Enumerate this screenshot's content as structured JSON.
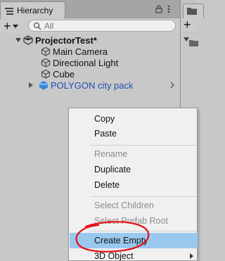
{
  "hierarchy": {
    "tab_title": "Hierarchy",
    "search_placeholder": "All",
    "scene_name": "ProjectorTest*",
    "items": [
      {
        "label": "Main Camera"
      },
      {
        "label": "Directional Light"
      },
      {
        "label": "Cube"
      },
      {
        "label": "POLYGON city pack"
      }
    ]
  },
  "context_menu": {
    "items": [
      {
        "label": "Copy",
        "enabled": true
      },
      {
        "label": "Paste",
        "enabled": true
      },
      {
        "label": "Rename",
        "enabled": false
      },
      {
        "label": "Duplicate",
        "enabled": true
      },
      {
        "label": "Delete",
        "enabled": true
      },
      {
        "label": "Select Children",
        "enabled": false
      },
      {
        "label": "Select Prefab Root",
        "enabled": false
      },
      {
        "label": "Create Empty",
        "enabled": true,
        "highlighted": true
      },
      {
        "label": "3D Object",
        "enabled": true,
        "has_submenu": true
      }
    ]
  },
  "colors": {
    "highlight": "#99c9ef",
    "prefab_text": "#1f4fb4",
    "annotation": "#e8141b"
  }
}
